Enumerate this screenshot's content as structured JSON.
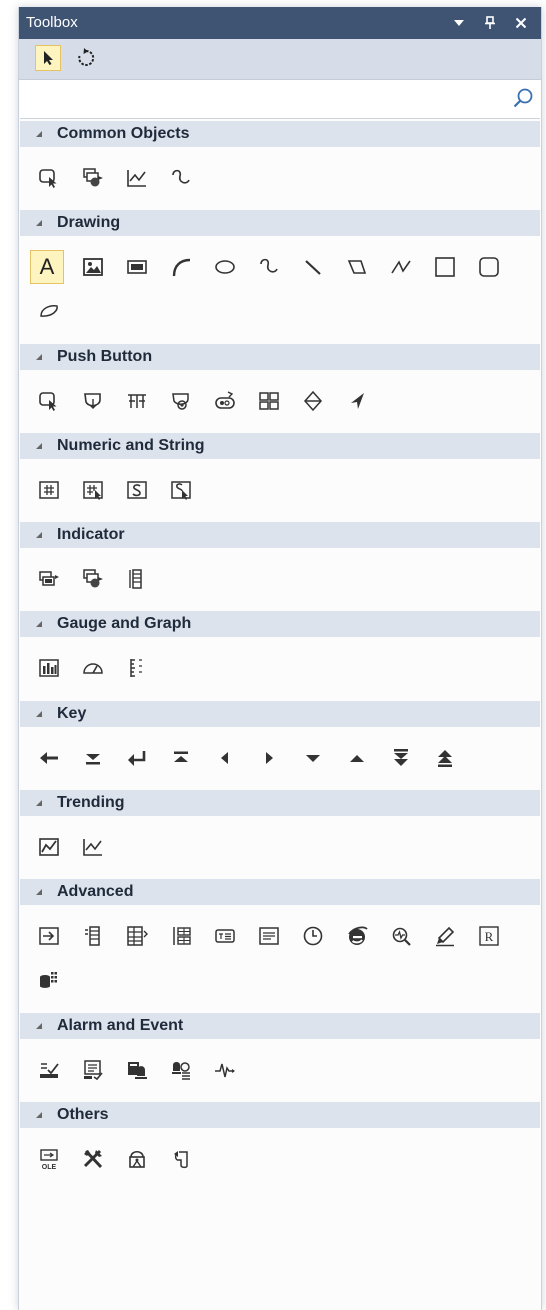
{
  "window": {
    "title": "Toolbox",
    "header_buttons": [
      "dropdown-arrow-icon",
      "pin-icon",
      "close-icon"
    ],
    "colors": {
      "titlebar": "#3f5472",
      "category_header": "#dde3ed",
      "selected_fill": "#fdf4bf",
      "selected_border": "#e5c365"
    }
  },
  "toolbar": {
    "tools": [
      {
        "icon": "pointer-icon",
        "selected": true
      },
      {
        "icon": "rotate-icon",
        "selected": false
      }
    ]
  },
  "search": {
    "value": "",
    "placeholder": "",
    "icon": "search-icon"
  },
  "categories": [
    {
      "label": "Common Objects",
      "items": [
        "object-select-icon",
        "multi-state-icon",
        "trend-chart-icon",
        "curve-icon"
      ]
    },
    {
      "label": "Drawing",
      "items": [
        "text-icon",
        "picture-icon",
        "filled-rectangle-icon",
        "arc-icon",
        "ellipse-icon",
        "freehand-icon",
        "line-icon",
        "polygon-icon",
        "polyline-icon",
        "rectangle-icon",
        "rounded-rectangle-icon",
        "cylinder-shape-icon"
      ],
      "text_item_label": "A"
    },
    {
      "label": "Push Button",
      "items": [
        "set-bit-button-icon",
        "set-word-button-icon",
        "function-key-icon",
        "combo-button-icon",
        "toggle-switch-icon",
        "multi-state-switch-icon",
        "slide-switch-icon",
        "direction-arrow-icon"
      ]
    },
    {
      "label": "Numeric and String",
      "items": [
        "numeric-display-icon",
        "numeric-input-icon",
        "string-display-icon",
        "string-input-icon"
      ]
    },
    {
      "label": "Indicator",
      "items": [
        "bit-lamp-icon",
        "word-lamp-icon",
        "bar-indicator-icon"
      ]
    },
    {
      "label": "Gauge and Graph",
      "items": [
        "bar-graph-icon",
        "meter-icon",
        "scale-icon"
      ]
    },
    {
      "label": "Key",
      "items": [
        "backspace-key-icon",
        "down-end-key-icon",
        "enter-key-icon",
        "up-end-key-icon",
        "left-key-icon",
        "right-key-icon",
        "down-key-icon",
        "up-key-icon",
        "page-down-key-icon",
        "page-up-key-icon"
      ]
    },
    {
      "label": "Trending",
      "items": [
        "trend-display-icon",
        "history-trend-icon"
      ]
    },
    {
      "label": "Advanced",
      "items": [
        "input-object-icon",
        "list-box-icon",
        "data-sheet-icon",
        "table-icon",
        "text-block-icon",
        "message-icon",
        "clock-icon",
        "web-browser-icon",
        "pdf-reader-icon",
        "sketch-pen-icon",
        "recipe-icon",
        "database-grid-icon"
      ],
      "recipe_label": "R"
    },
    {
      "label": "Alarm and Event",
      "items": [
        "alarm-bar-icon",
        "alarm-display-icon",
        "event-display-icon",
        "alarm-summary-icon",
        "event-log-icon"
      ]
    },
    {
      "label": "Others",
      "items": [
        "ole-object-icon",
        "tools-icon",
        "security-icon",
        "macro-icon"
      ],
      "ole_label": "OLE"
    }
  ]
}
